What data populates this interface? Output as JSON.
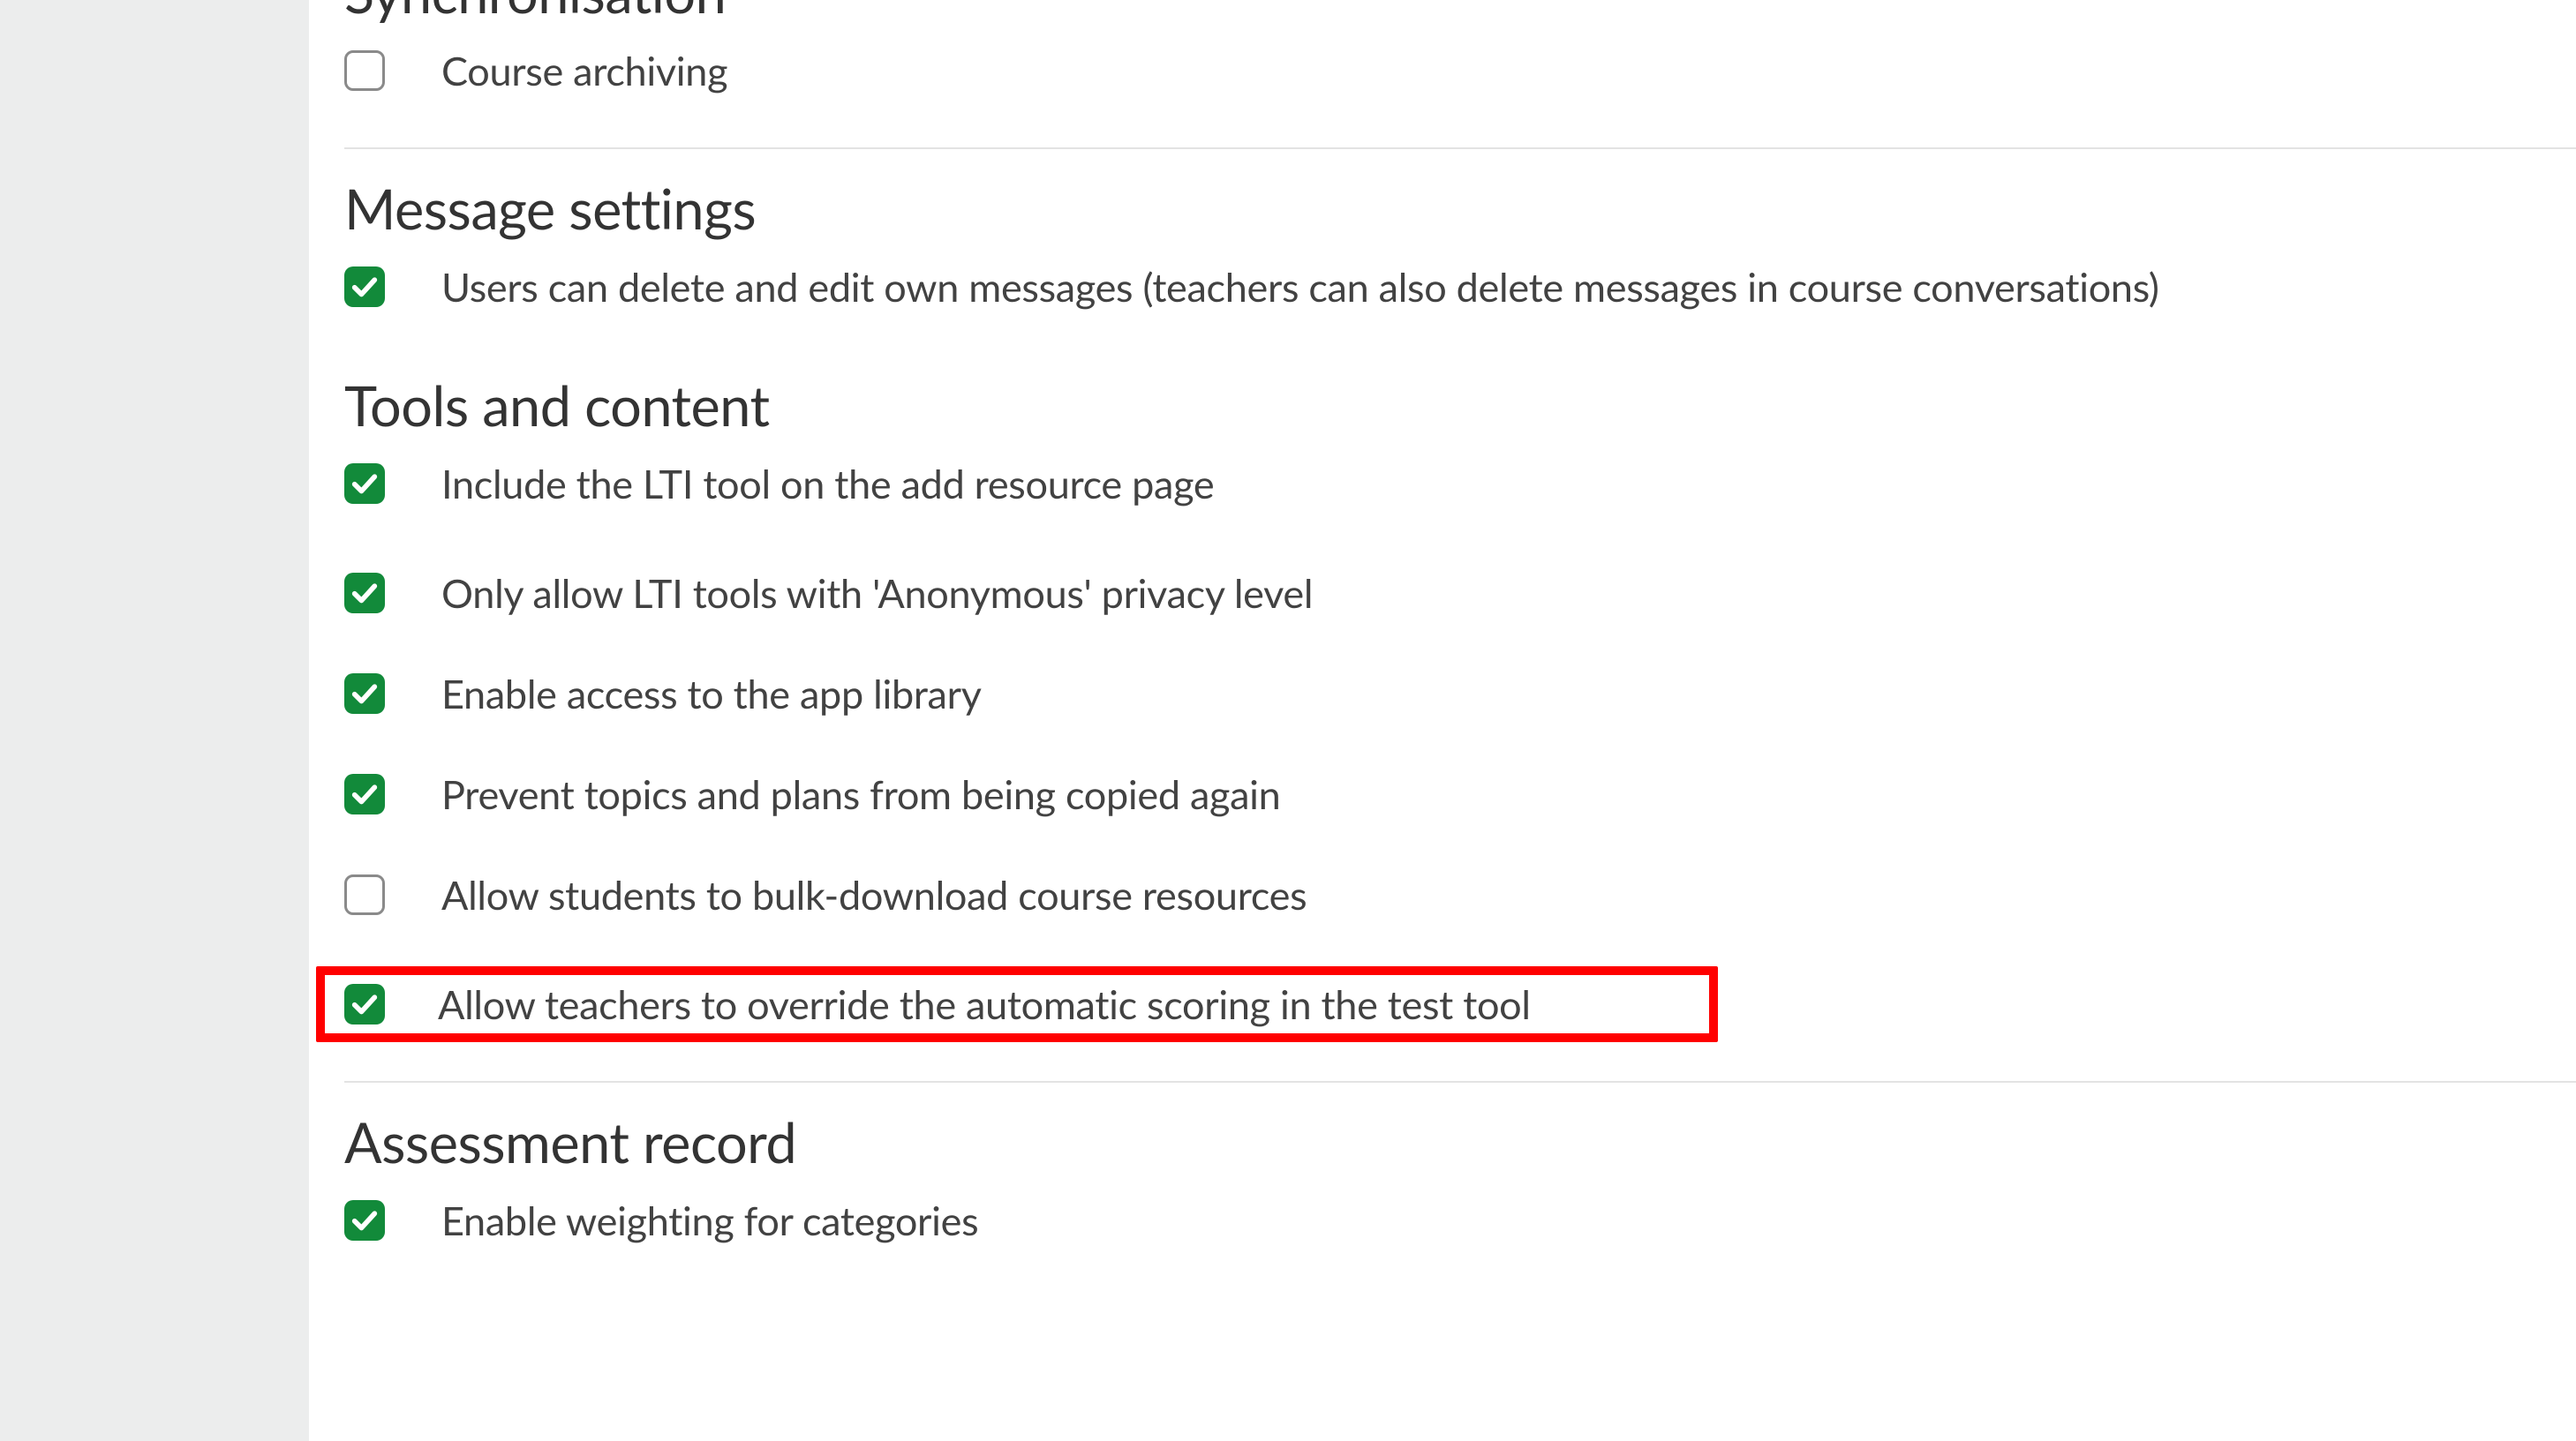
{
  "sections": {
    "sync": {
      "title": "Synchronisation",
      "options": {
        "archive": {
          "label": "Course archiving",
          "checked": false
        }
      }
    },
    "messages": {
      "title": "Message settings",
      "options": {
        "delete_edit": {
          "label": "Users can delete and edit own messages (teachers can also delete messages in course conversations)",
          "checked": true
        }
      }
    },
    "tools": {
      "title": "Tools and content",
      "options": {
        "lti_include": {
          "label": "Include the LTI tool on the add resource page",
          "checked": true
        },
        "lti_anon": {
          "label": "Only allow LTI tools with 'Anonymous' privacy level",
          "checked": true
        },
        "app_library": {
          "label": "Enable access to the app library",
          "checked": true
        },
        "prevent_copy": {
          "label": "Prevent topics and plans from being copied again",
          "checked": true
        },
        "bulk_dl": {
          "label": "Allow students to bulk-download course resources",
          "checked": false
        },
        "override": {
          "label": "Allow teachers to override the automatic scoring in the test tool",
          "checked": true
        }
      }
    },
    "assessment": {
      "title": "Assessment record",
      "options": {
        "weighting": {
          "label": "Enable weighting for categories",
          "checked": true
        }
      }
    }
  },
  "colors": {
    "checkbox_green": "#128a3a",
    "highlight_red": "#ff0000"
  }
}
